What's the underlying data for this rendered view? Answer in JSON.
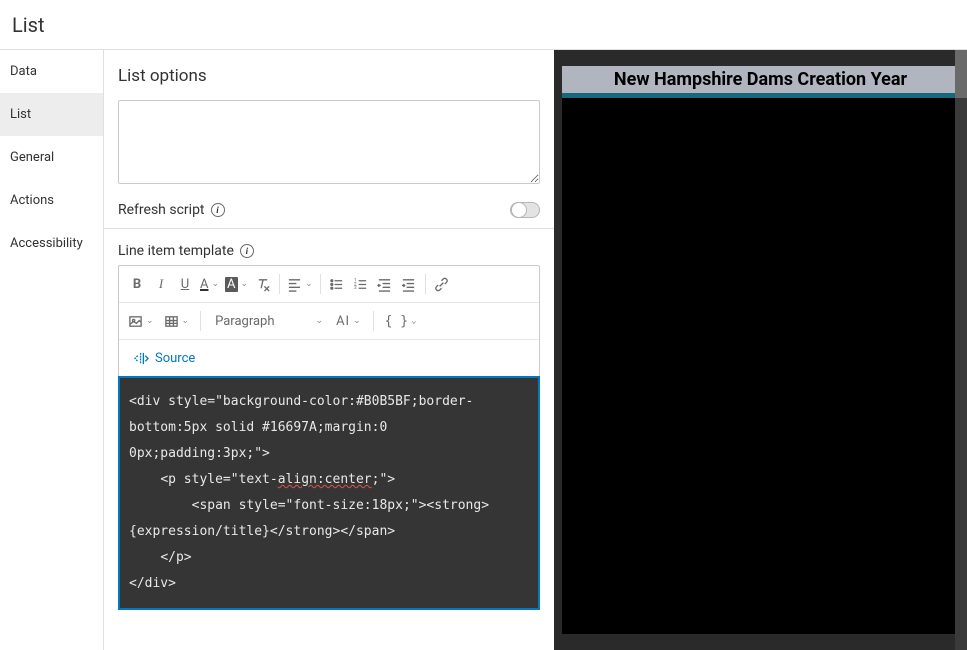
{
  "header": {
    "title": "List"
  },
  "sidebar": {
    "items": [
      {
        "label": "Data",
        "selected": false
      },
      {
        "label": "List",
        "selected": true
      },
      {
        "label": "General",
        "selected": false
      },
      {
        "label": "Actions",
        "selected": false
      },
      {
        "label": "Accessibility",
        "selected": false
      }
    ]
  },
  "panel": {
    "title": "List options",
    "refresh_label": "Refresh script",
    "template_label": "Line item template",
    "paragraph_label": "Paragraph",
    "ai_label": "AI",
    "braces_label": "{ }",
    "source_label": "Source",
    "code_lines": [
      "<div style=\"background-color:#B0B5BF;border-",
      "bottom:5px solid #16697A;margin:0 ",
      "0px;padding:3px;\">",
      "    <p style=\"text-align:center;\">",
      "        <span style=\"font-size:18px;\"><strong>",
      "{expression/title}</strong></span>",
      "    </p>",
      "</div>"
    ]
  },
  "preview": {
    "banner_text": "New Hampshire Dams Creation Year"
  },
  "colors": {
    "accent": "#0079c1",
    "banner_bg": "#B0B5BF",
    "banner_border": "#16697A"
  }
}
